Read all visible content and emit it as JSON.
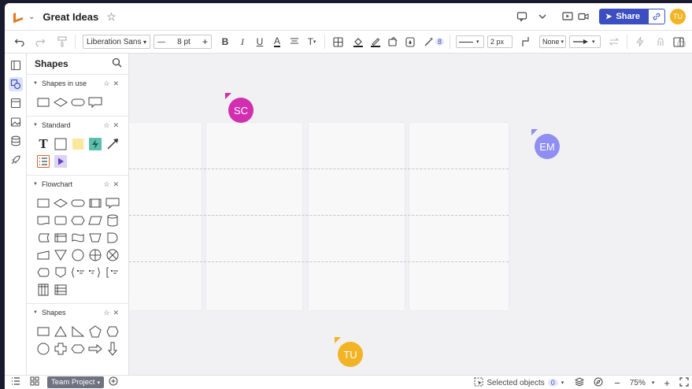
{
  "titlebar": {
    "doc_title": "Great Ideas",
    "share_label": "Share",
    "user_initials": "TU"
  },
  "toolbar": {
    "font_family": "Liberation Sans",
    "font_size": "8 pt",
    "bold": "B",
    "italic": "I",
    "underline": "U",
    "text_color": "A",
    "text_options": "T",
    "badge_count": "8",
    "stroke_width": "2 px",
    "endpoint_start": "None"
  },
  "panel": {
    "title": "Shapes",
    "sections": [
      {
        "title": "Shapes in use"
      },
      {
        "title": "Standard"
      },
      {
        "title": "Flowchart"
      },
      {
        "title": "Shapes"
      }
    ],
    "standard_text_glyph": "T"
  },
  "collaborators": [
    {
      "initials": "SC",
      "color": "#d22fb0"
    },
    {
      "initials": "EM",
      "color": "#8f8ef2"
    },
    {
      "initials": "TU",
      "color": "#f2b425"
    }
  ],
  "statusbar": {
    "project_label": "Team Project",
    "selected_label": "Selected objects",
    "selected_count": "0",
    "zoom": "75%"
  },
  "colors": {
    "accent": "#3b4ec2",
    "brand_orange": "#e07b22"
  }
}
